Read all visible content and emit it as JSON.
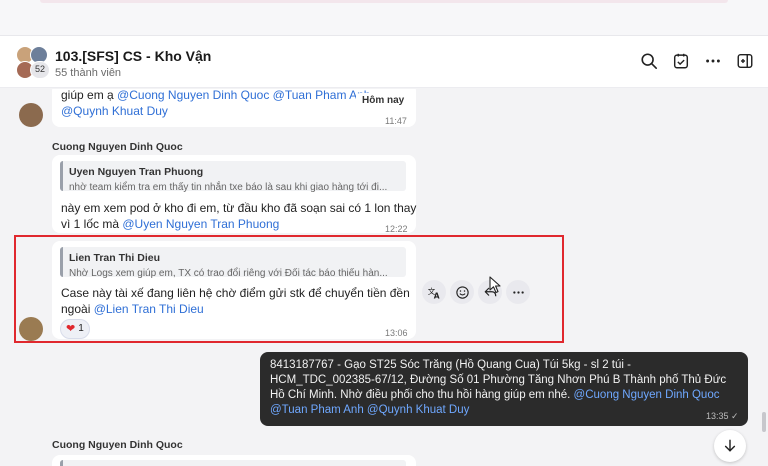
{
  "header": {
    "title": "103.[SFS] CS - Kho Vận",
    "subtitle": "55 thành viên",
    "avatar_count": "52",
    "icons": [
      "search-icon",
      "todo-check-icon",
      "more-icon",
      "sidebar-toggle-icon"
    ]
  },
  "chat": {
    "day_badge": "Hôm nay",
    "msg1": {
      "text_prefix": "giúp em ạ ",
      "mention1": "@Cuong Nguyen Dinh Quoc",
      "mention2": "@Tuan Pham Anh",
      "mention3": "@Quynh Khuat Duy",
      "time": "11:47"
    },
    "msg2": {
      "sender": "Cuong Nguyen Dinh Quoc",
      "quote_name": "Uyen Nguyen Tran Phuong",
      "quote_text": "nhờ team kiểm tra em thấy tin nhắn txe báo là sau khi giao hàng tới đi...",
      "text_line1": "này em xem pod ở kho đi em, từ đầu kho đã soạn sai có 1 lon thay",
      "text_line2_prefix": "vì 1 lốc mà ",
      "mention": "@Uyen Nguyen Tran Phuong",
      "time": "12:22"
    },
    "msg3": {
      "quote_name": "Lien Tran Thi Dieu",
      "quote_text": "Nhờ Logs xem giúp em, TX có trao đổi riêng với Đối tác báo thiếu hàn...",
      "text_line1": "Case này tài xế đang liên hệ chờ điểm gửi stk để chuyển tiền đền",
      "text_line2_prefix": "ngoài ",
      "mention": "@Lien Tran Thi Dieu",
      "reaction_count": "1",
      "time": "13:06"
    },
    "out_msg": {
      "text": "8413187767 - Gạo ST25 Sóc Trăng (Hồ Quang Cua) Túi 5kg - sl 2 túi - HCM_TDC_002385-67/12, Đường Số 01 Phường Tăng Nhơn Phú B Thành phố Thủ Đức Hồ Chí Minh. Nhờ điều phối cho thu hồi hàng giúp em nhé. ",
      "mention1": "@Cuong Nguyen Dinh Quoc",
      "mention2": "@Tuan Pham Anh",
      "mention3": "@Quynh Khuat Duy",
      "time": "13:35 ✓"
    },
    "msg4": {
      "sender": "Cuong Nguyen Dinh Quoc"
    }
  },
  "colors": {
    "mention": "#2f6fd6",
    "highlight": "#e0282e",
    "out_bubble": "#2b2b2b"
  }
}
